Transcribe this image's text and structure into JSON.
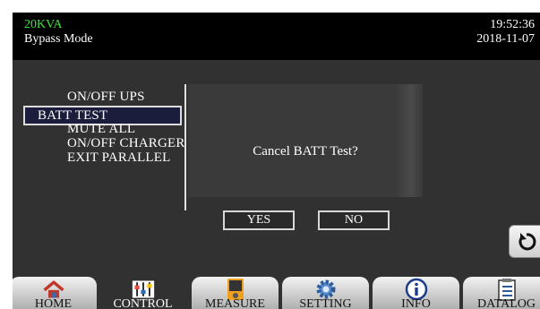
{
  "header": {
    "model": "20KVA",
    "mode": "Bypass Mode",
    "time": "19:52:36",
    "date": "2018-11-07"
  },
  "menu": {
    "items": [
      "ON/OFF UPS",
      "BATT TEST",
      "MUTE ALL",
      "ON/OFF CHARGER",
      "EXIT PARALLEL"
    ],
    "selected": "BATT TEST"
  },
  "dialog": {
    "message": "Cancel BATT Test?",
    "yes_label": "YES",
    "no_label": "NO"
  },
  "back_button": {
    "icon": "refresh-back-icon"
  },
  "tabs": [
    {
      "label": "HOME",
      "icon": "home-icon"
    },
    {
      "label": "CONTROL",
      "icon": "sliders-icon"
    },
    {
      "label": "MEASURE",
      "icon": "meter-icon"
    },
    {
      "label": "SETTING",
      "icon": "gear-icon"
    },
    {
      "label": "INFO",
      "icon": "info-icon"
    },
    {
      "label": "DATALOG",
      "icon": "clipboard-icon"
    }
  ],
  "active_tab": "CONTROL",
  "colors": {
    "model_text": "#37e637",
    "selected_bg": "#1a1e3c"
  }
}
